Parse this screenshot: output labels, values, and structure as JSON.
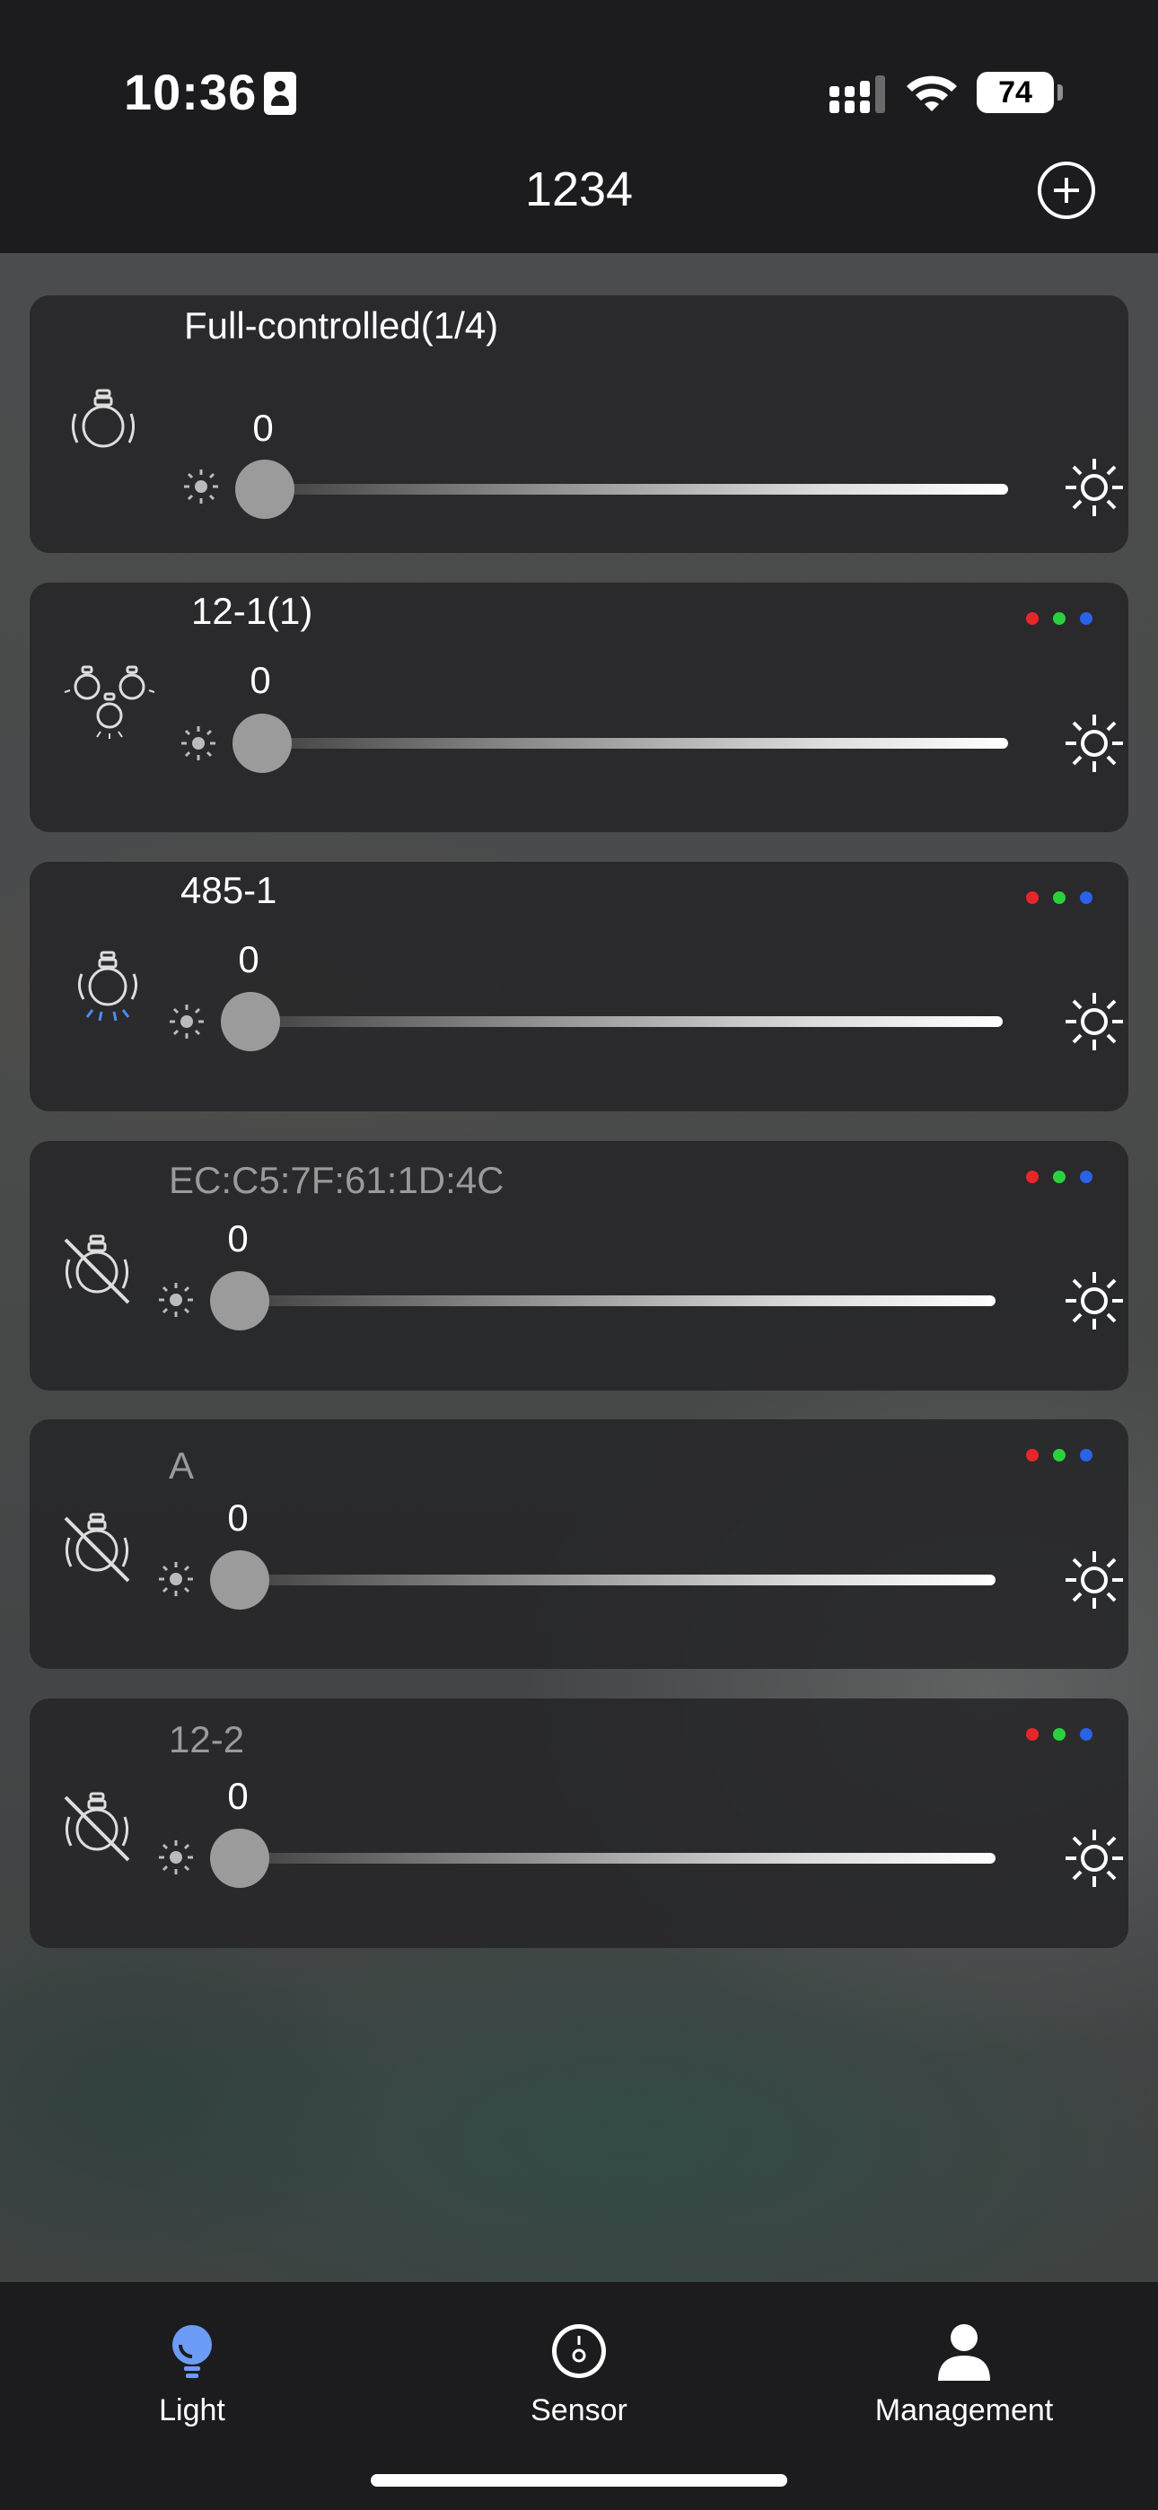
{
  "status_bar": {
    "time": "10:36",
    "battery": "74"
  },
  "header": {
    "title": "1234",
    "add_icon": "plus-circle-icon"
  },
  "devices": [
    {
      "name": "Full-controlled(1/4)",
      "brightness": 0,
      "icon": "bulb-icon",
      "rgb_indicator": false,
      "online": true
    },
    {
      "name": "12-1(1)",
      "brightness": 0,
      "icon": "bulb-group-icon",
      "rgb_indicator": true,
      "online": true
    },
    {
      "name": "485-1",
      "brightness": 0,
      "icon": "bulb-blue-rays-icon",
      "rgb_indicator": true,
      "online": true
    },
    {
      "name": "EC:C5:7F:61:1D:4C",
      "brightness": 0,
      "icon": "bulb-offline-icon",
      "rgb_indicator": true,
      "online": false
    },
    {
      "name": "A",
      "brightness": 0,
      "icon": "bulb-offline-icon",
      "rgb_indicator": true,
      "online": false
    },
    {
      "name": "12-2",
      "brightness": 0,
      "icon": "bulb-offline-icon",
      "rgb_indicator": true,
      "online": false
    }
  ],
  "rgb_colors": [
    "#e8262a",
    "#2bd13d",
    "#2a62e8"
  ],
  "tabs": [
    {
      "label": "Light",
      "icon": "lightbulb-icon",
      "active": true
    },
    {
      "label": "Sensor",
      "icon": "sensor-icon",
      "active": false
    },
    {
      "label": "Management",
      "icon": "person-icon",
      "active": false
    }
  ],
  "colors": {
    "background": "#1c1c1e",
    "active_tab_icon": "#6c9cf5"
  }
}
